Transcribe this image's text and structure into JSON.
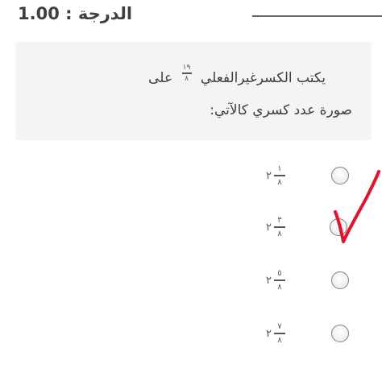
{
  "grade": {
    "text": "الدرجة : 1.00"
  },
  "question": {
    "line1_prefix": "يكتب الكسرغيرالفعلي",
    "fraction": {
      "numerator": "١٩",
      "denominator": "٨"
    },
    "line1_suffix": "على",
    "line2": "صورة عدد كسري كالآتي:"
  },
  "options": [
    {
      "whole": "٢",
      "numerator": "١",
      "denominator": "٨",
      "selected": false
    },
    {
      "whole": "٢",
      "numerator": "٣",
      "denominator": "٨",
      "selected": true
    },
    {
      "whole": "٢",
      "numerator": "٥",
      "denominator": "٨",
      "selected": false
    },
    {
      "whole": "٢",
      "numerator": "٧",
      "denominator": "٨",
      "selected": false
    }
  ],
  "annotation": {
    "checkmark_color": "#e8102a",
    "checkmark_icon": "handdrawn-checkmark-icon"
  }
}
